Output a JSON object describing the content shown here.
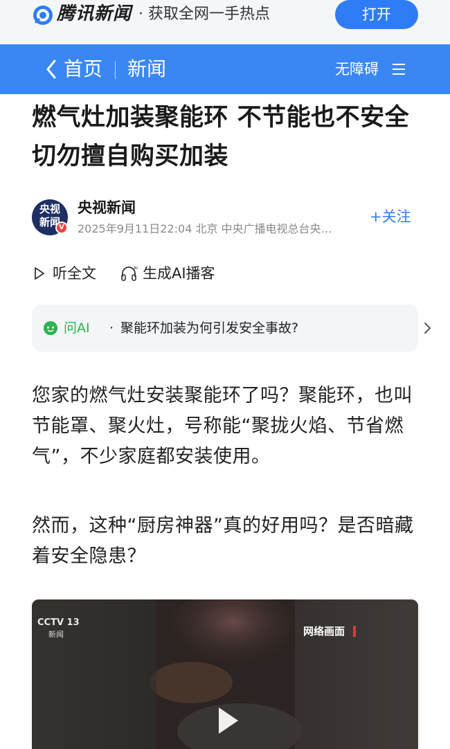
{
  "promo": {
    "brand": "腾讯新闻",
    "slogan": "· 获取全网一手热点",
    "open_label": "打开"
  },
  "nav": {
    "home": "首页",
    "channel": "新闻",
    "accessibility": "无障碍"
  },
  "article": {
    "title": "燃气灶加装聚能环 不节能也不安全 切勿擅自购买加装",
    "author": {
      "avatar_text": "央视新闻",
      "name": "央视新闻",
      "meta": "2025年9月11日22:04  北京  中央广播电视总台央…"
    },
    "follow_label": "+关注",
    "listen_label": "听全文",
    "podcast_label": "生成AI播客",
    "ask": {
      "label": "问AI",
      "dot": "·",
      "question": "聚能环加装为何引发安全事故?"
    },
    "paragraphs": [
      "您家的燃气灶安装聚能环了吗？聚能环，也叫节能罩、聚火灶，号称能“聚拢火焰、节省燃气”，不少家庭都安装使用。",
      "然而，这种“厨房神器”真的好用吗？是否暗藏着安全隐患？"
    ],
    "video": {
      "logo": "CCTV 13",
      "logo_sub": "新闻",
      "overlay": "网络画面"
    }
  },
  "colors": {
    "accent_blue": "#3a87f4",
    "button_blue": "#2f7df6",
    "ai_green": "#2ab34e"
  }
}
